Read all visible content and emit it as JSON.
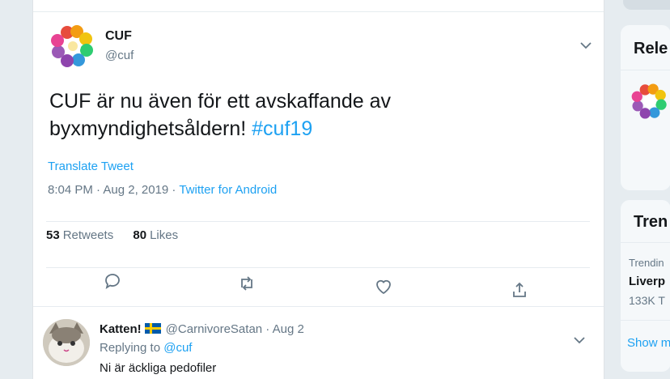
{
  "tweet": {
    "author_name": "CUF",
    "author_handle": "@cuf",
    "text_main": "CUF är nu även för ett avskaffande av byxmyndighetsåldern!",
    "hashtag": "#cuf19",
    "translate_label": "Translate Tweet",
    "timestamp": "8:04 PM · Aug 2, 2019 ·",
    "source": "Twitter for Android",
    "retweets_count": "53",
    "retweets_label": "Retweets",
    "likes_count": "80",
    "likes_label": "Likes"
  },
  "reply": {
    "name": "Katten!",
    "handle": "@CarnivoreSatan",
    "time": "· Aug 2",
    "replying_prefix": "Replying to",
    "replying_to": "@cuf",
    "text": "Ni är äckliga pedofiler"
  },
  "sidebar": {
    "relevant_title": "Rele",
    "trends_title": "Tren",
    "trend_context": "Trendin",
    "trend_name": "Liverp",
    "trend_count": "133K T",
    "show_more": "Show m"
  },
  "icons": {
    "reply": "reply-icon",
    "retweet": "retweet-icon",
    "like": "heart-icon",
    "share": "share-icon",
    "caret": "chevron-down-icon",
    "flag": "swedish-flag-icon"
  },
  "colors": {
    "accent": "#1da1f2",
    "muted": "#657786",
    "text": "#14171a"
  }
}
